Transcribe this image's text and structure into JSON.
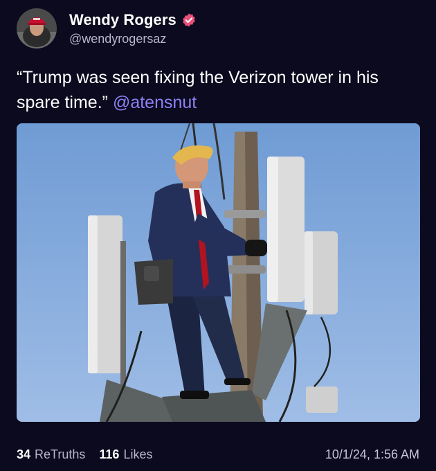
{
  "author": {
    "display_name": "Wendy Rogers",
    "handle": "@wendyrogersaz",
    "verified_icon": "verified-badge-icon",
    "avatar_icon": "avatar-photo"
  },
  "post": {
    "text": "“Trump was seen fixing the Verizon tower in his spare time.”",
    "mention": "@atensnut"
  },
  "stats": {
    "retruths_count": "34",
    "retruths_label": "ReTruths",
    "likes_count": "116",
    "likes_label": "Likes"
  },
  "timestamp": "10/1/24, 1:56 AM",
  "colors": {
    "background": "#0b0a1e",
    "accent": "#8f80f5",
    "verified": "#e9507a",
    "muted_text": "#b9b7c9"
  }
}
